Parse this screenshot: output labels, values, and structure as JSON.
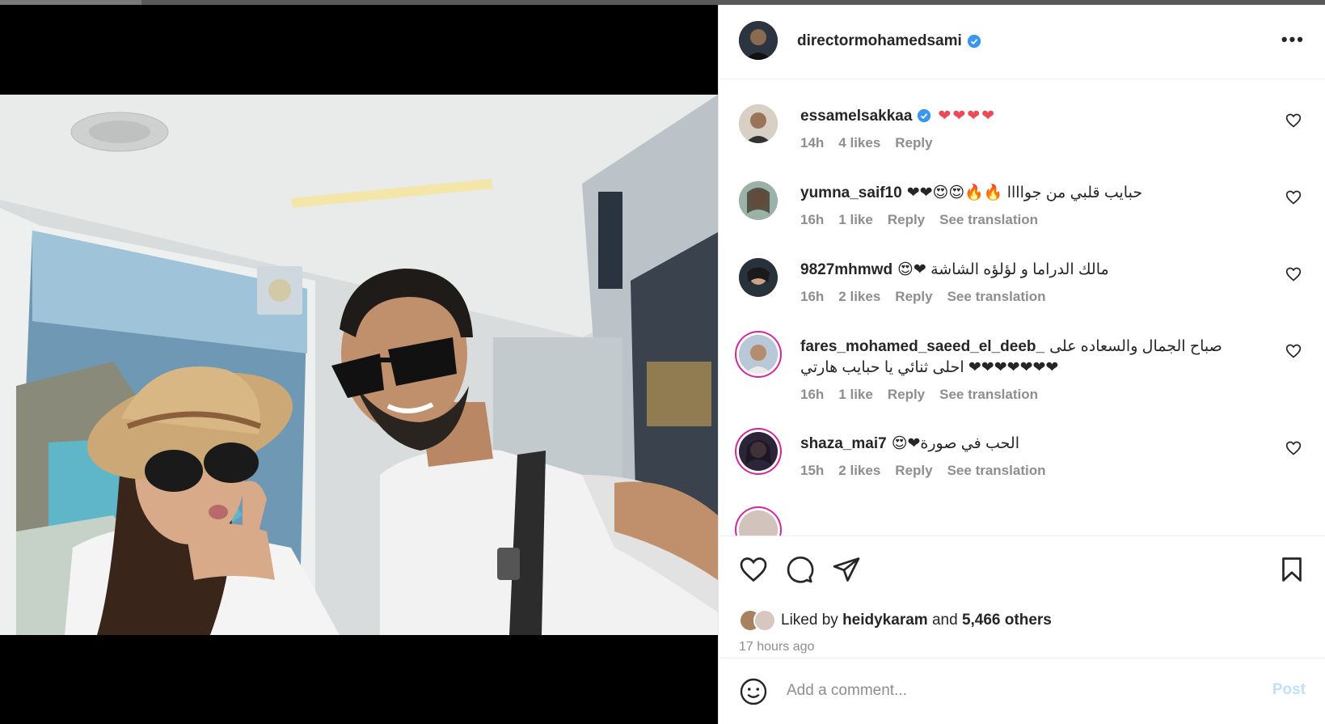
{
  "post": {
    "author": "directormohamedsami",
    "more_label": "•••"
  },
  "comments": [
    {
      "user": "essamelsakkaa",
      "verified": true,
      "text": "❤❤❤❤",
      "time": "14h",
      "likes": "4 likes",
      "reply": "Reply",
      "translate": ""
    },
    {
      "user": "yumna_saif10",
      "verified": false,
      "text": "❤❤😍😍🔥🔥 حبايب قلبي من جواااا",
      "time": "16h",
      "likes": "1 like",
      "reply": "Reply",
      "translate": "See translation"
    },
    {
      "user": "9827mhmwd",
      "verified": false,
      "text": "😍❤ مالك الدراما و لؤلؤه الشاشة",
      "time": "16h",
      "likes": "2 likes",
      "reply": "Reply",
      "translate": "See translation"
    },
    {
      "user": "fares_mohamed_saeed_el_deeb_",
      "verified": false,
      "text": "صباح الجمال والسعاده على احلى ثنائي يا حبايب هارتي ❤❤❤❤❤❤❤",
      "time": "16h",
      "likes": "1 like",
      "reply": "Reply",
      "translate": "See translation"
    },
    {
      "user": "shaza_mai7",
      "verified": false,
      "text": "😍❤الحب في صورة",
      "time": "15h",
      "likes": "2 likes",
      "reply": "Reply",
      "translate": "See translation"
    }
  ],
  "likes": {
    "prefix": "Liked by",
    "user": "heidykaram",
    "and": "and",
    "others": "5,466 others"
  },
  "time_ago": "17 hours ago",
  "add_comment": {
    "placeholder": "Add a comment...",
    "post_label": "Post"
  },
  "colors": {
    "verified": "#3897f0",
    "heart": "#ed4956",
    "post_disabled": "#c0dffd",
    "meta": "#8e8e8e"
  },
  "icons": [
    "heart-icon",
    "comment-icon",
    "share-icon",
    "bookmark-icon",
    "emoji-icon",
    "verified-icon",
    "more-icon"
  ]
}
